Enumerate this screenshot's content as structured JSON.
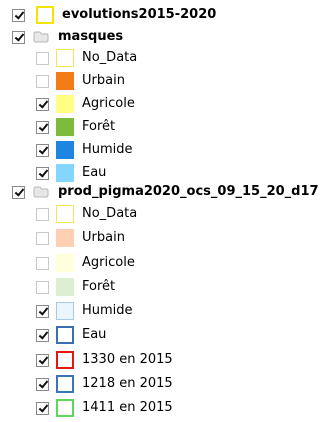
{
  "layers": {
    "evolutions": {
      "label": "evolutions2015-2020",
      "checked": true,
      "symbol": {
        "fill": "#ffffff",
        "border": "#f2e600"
      }
    },
    "masques": {
      "label": "masques",
      "checked": true,
      "icon": "group-layer-icon",
      "items": [
        {
          "label": "No_Data",
          "checked": false,
          "fill": "#ffffff",
          "border": "#f7e45a"
        },
        {
          "label": "Urbain",
          "checked": false,
          "fill": "#f47c16",
          "border": "#f47c16"
        },
        {
          "label": "Agricole",
          "checked": true,
          "fill": "#ffff85",
          "border": "#ffff85"
        },
        {
          "label": "Forêt",
          "checked": true,
          "fill": "#7cbb3c",
          "border": "#7cbb3c"
        },
        {
          "label": "Humide",
          "checked": true,
          "fill": "#1e86e1",
          "border": "#1e86e1"
        },
        {
          "label": "Eau",
          "checked": true,
          "fill": "#84d6ff",
          "border": "#84d6ff"
        }
      ]
    },
    "prod": {
      "label": "prod_pigma2020_ocs_09_15_20_d17",
      "checked": true,
      "icon": "group-layer-icon",
      "items": [
        {
          "label": "No_Data",
          "checked": false,
          "fill": "#ffffff",
          "border": "#f7e45a"
        },
        {
          "label": "Urbain",
          "checked": false,
          "fill": "#ffcfb3",
          "border": "#ffcfb3"
        },
        {
          "label": "Agricole",
          "checked": false,
          "fill": "#ffffe0",
          "border": "#ffffd0"
        },
        {
          "label": "Forêt",
          "checked": false,
          "fill": "#deeed0",
          "border": "#deeed0"
        },
        {
          "label": "Humide",
          "checked": true,
          "fill": "#e9f5ff",
          "border": "#a8c8e8"
        },
        {
          "label": "Eau",
          "checked": true,
          "fill": "#ffffff",
          "border": "#3a6fb0"
        },
        {
          "label": "1330 en 2015",
          "checked": true,
          "fill": "#ffffff",
          "border": "#e01818"
        },
        {
          "label": "1218 en 2015",
          "checked": true,
          "fill": "#ffffff",
          "border": "#3b73b8"
        },
        {
          "label": "1411 en 2015",
          "checked": true,
          "fill": "#ffffff",
          "border": "#5cd75c"
        }
      ]
    }
  }
}
